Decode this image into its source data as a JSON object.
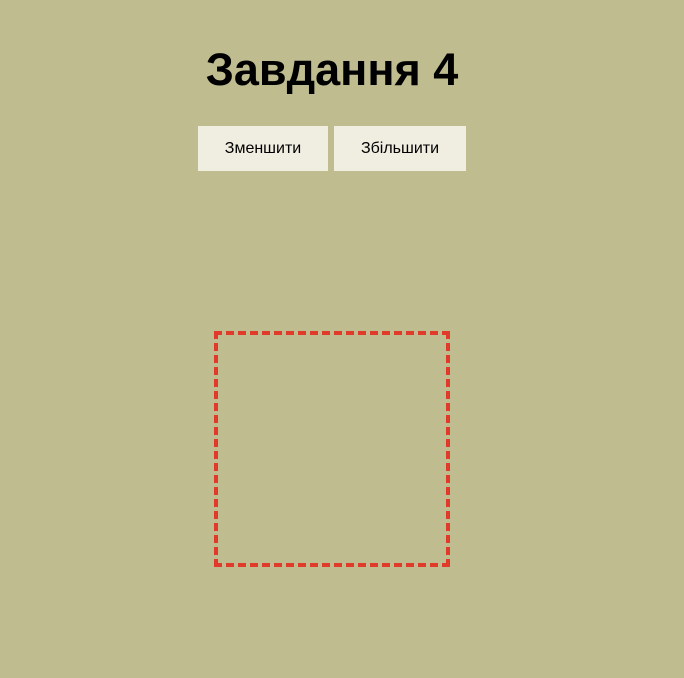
{
  "page": {
    "title": "Завдання 4"
  },
  "controls": {
    "decrease_label": "Зменшити",
    "increase_label": "Збільшити"
  },
  "colors": {
    "background": "#bfbc90",
    "button_background": "#f0ede1",
    "box_border": "#e23a2a"
  }
}
